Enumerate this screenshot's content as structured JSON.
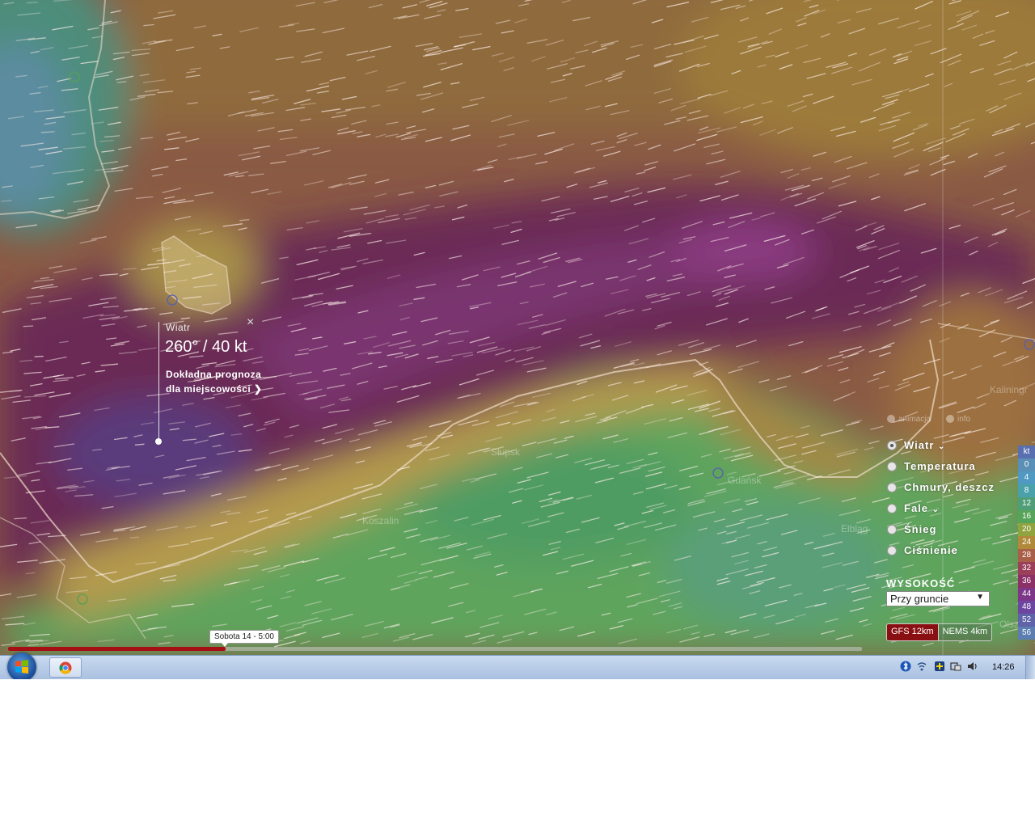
{
  "popup": {
    "title": "Wiatr",
    "value": "260° / 40 kt",
    "link_line1": "Dokładna prognoza",
    "link_line2": "dla miejscowości",
    "close": "×"
  },
  "cities": {
    "koszalin": "Koszalin",
    "slupsk": "Słupsk",
    "gdansk": "Gdańsk",
    "elblag": "Elbląg",
    "kaliningrad": "Kaliningr",
    "olsztyn": "Olsz"
  },
  "top_options": {
    "animation": "animacja",
    "info": "info"
  },
  "layers": [
    {
      "label": "Wiatr",
      "selected": true,
      "has_dropdown": true
    },
    {
      "label": "Temperatura",
      "selected": false,
      "has_dropdown": false
    },
    {
      "label": "Chmury, deszcz",
      "selected": false,
      "has_dropdown": false
    },
    {
      "label": "Fale",
      "selected": false,
      "has_dropdown": true
    },
    {
      "label": "Śnieg",
      "selected": false,
      "has_dropdown": false
    },
    {
      "label": "Ciśnienie",
      "selected": false,
      "has_dropdown": false
    }
  ],
  "height": {
    "title": "WYSOKOŚĆ",
    "selected": "Przy gruncie"
  },
  "models": {
    "active": "GFS 12km",
    "inactive": "NEMS 4km"
  },
  "legend": {
    "unit": "kt",
    "values": [
      "0",
      "4",
      "8",
      "12",
      "16",
      "20",
      "24",
      "28",
      "32",
      "36",
      "44",
      "48",
      "52",
      "56"
    ],
    "colors": [
      "#5b8fb5",
      "#4f99c3",
      "#4aa1aa",
      "#4f9e78",
      "#56a45a",
      "#8fa33f",
      "#b08a3a",
      "#a96048",
      "#9c3f5a",
      "#8c3168",
      "#7d3788",
      "#6c46a0",
      "#5f63a8",
      "#5c7eb0"
    ]
  },
  "timeline": {
    "label": "Sobota 14 - 5:00",
    "progress": 0.255
  },
  "taskbar": {
    "clock": "14:26"
  },
  "colors": {
    "accent": "#a50f14",
    "sea_wind": "#6e2e5a",
    "land": "#5ea35b"
  }
}
